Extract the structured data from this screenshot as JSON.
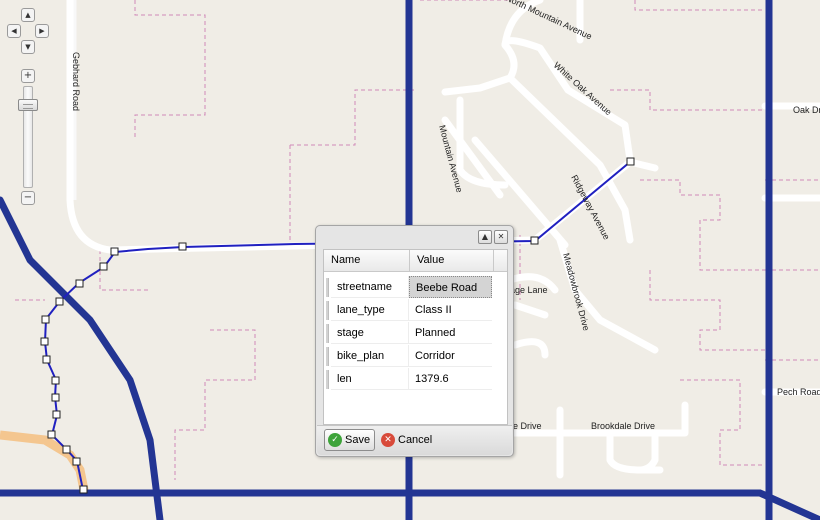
{
  "map": {
    "street_labels": {
      "north_mountain_avenue": "North Mountain Avenue",
      "gebhard_road": "Gebhard Road",
      "white_oak_avenue": "White Oak Avenue",
      "oak_dr": "Oak Dr",
      "mountain_avenue": "Mountain Avenue",
      "ridgeway_avenue": "Ridgeway Avenue",
      "meadowbrook_drive": "Meadowbrook Drive",
      "age_lane": "age Lane",
      "e_drive": "e Drive",
      "brookdale_drive": "Brookdale Drive",
      "pech_road": "Pech Road"
    },
    "colors": {
      "background": "#f0ede6",
      "streets": "#ffffff",
      "bike_route": "#233593",
      "selected_feature": "#2020c0",
      "boundary": "#d089b8",
      "highlight_road": "#f4c68f"
    }
  },
  "controls": {
    "pan_up_icon": "▲",
    "pan_left_icon": "◀",
    "pan_right_icon": "▶",
    "pan_down_icon": "▼",
    "zoom_in_label": "+",
    "zoom_out_label": "−"
  },
  "popup": {
    "collapse_icon": "▲",
    "close_icon": "✕",
    "grid": {
      "columns": [
        "Name",
        "Value"
      ],
      "rows": [
        {
          "name": "streetname",
          "value": "Beebe Road"
        },
        {
          "name": "lane_type",
          "value": "Class II"
        },
        {
          "name": "stage",
          "value": "Planned"
        },
        {
          "name": "bike_plan",
          "value": "Corridor"
        },
        {
          "name": "len",
          "value": "1379.6"
        }
      ]
    },
    "save_icon": "✓",
    "save_label": "Save",
    "cancel_icon": "✕",
    "cancel_label": "Cancel"
  }
}
